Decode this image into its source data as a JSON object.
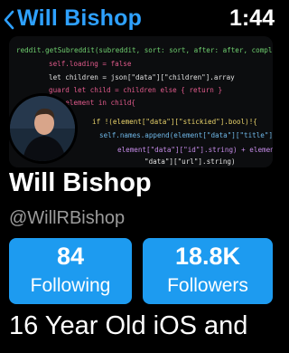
{
  "header": {
    "back_icon": "chevron-left-icon",
    "title": "Will Bishop",
    "time": "1:44",
    "accent": "#2ea1ff"
  },
  "profile": {
    "name": "Will Bishop",
    "handle": "@WillRBishop",
    "bio": "16 Year Old iOS and"
  },
  "stats": {
    "following": {
      "value": "84",
      "label": "Following"
    },
    "followers": {
      "value": "18.8K",
      "label": "Followers"
    },
    "button_color": "#1d9bf0"
  },
  "banner_code": [
    "reddit.getSubreddit(subreddit, sort: sort, after: after, completionHandler",
    "self.loading = false",
    "let children = json[\"data\"][\"children\"].array",
    "guard let child = children else { return }",
    "for element in child{",
    "if !(element[\"data\"][\"stickied\"].bool)!{",
    "self.names.append(element[\"data\"][\"title\"].string)",
    "element[\"data\"][\"id\"].string) + element[\"data\"]",
    "\"data\"][\"url\"].string)"
  ]
}
